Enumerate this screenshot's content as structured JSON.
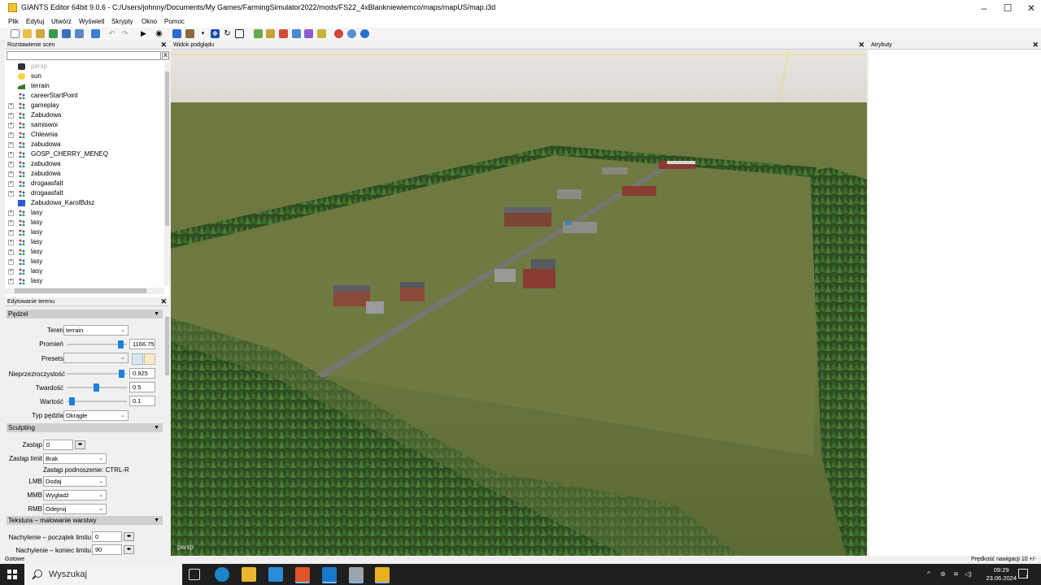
{
  "window": {
    "title": "GIANTS Editor 64bit 9.0.6 - C:/Users/johnny/Documents/My Games/FarmingSimulator2022/mods/FS22_4xBlankniewiemco/maps/mapUS/map.i3d"
  },
  "menubar": {
    "items": [
      "Plik",
      "Edytuj",
      "Utwórz",
      "Wyświetl",
      "Skrypty",
      "Okno",
      "Pomoc"
    ]
  },
  "scene_panel": {
    "title": "Rozstawienie scen",
    "search_clear": "X",
    "tree": [
      {
        "label": "persp",
        "icon": "camera-icon",
        "expandable": false,
        "dim": true
      },
      {
        "label": "sun",
        "icon": "bulb-icon",
        "expandable": false
      },
      {
        "label": "terrain",
        "icon": "terrain-icon",
        "expandable": false
      },
      {
        "label": "careerStartPoint",
        "icon": "transformgroup-icon",
        "expandable": false
      },
      {
        "label": "gameplay",
        "icon": "transformgroup-icon",
        "expandable": true
      },
      {
        "label": "Zabudowa",
        "icon": "transformgroup-icon",
        "expandable": true
      },
      {
        "label": "samiswoi",
        "icon": "transformgroup-icon",
        "expandable": true
      },
      {
        "label": "Chlewnia",
        "icon": "transformgroup-icon",
        "expandable": true
      },
      {
        "label": "zabudowa",
        "icon": "transformgroup-icon",
        "expandable": true
      },
      {
        "label": "GOSP_CHERRY_MENEQ",
        "icon": "transformgroup-icon",
        "expandable": true
      },
      {
        "label": "zabudowa",
        "icon": "transformgroup-icon",
        "expandable": true
      },
      {
        "label": "zabudowa",
        "icon": "transformgroup-icon",
        "expandable": true
      },
      {
        "label": "drogaasfalt",
        "icon": "transformgroup-icon",
        "expandable": true
      },
      {
        "label": "drogaasfalt",
        "icon": "transformgroup-icon",
        "expandable": true
      },
      {
        "label": "Zabudowa_KarolBdsz",
        "icon": "cube-icon",
        "expandable": false
      },
      {
        "label": "lasy",
        "icon": "transformgroup-icon",
        "expandable": true
      },
      {
        "label": "lasy",
        "icon": "transformgroup-icon",
        "expandable": true
      },
      {
        "label": "lasy",
        "icon": "transformgroup-icon",
        "expandable": true
      },
      {
        "label": "lasy",
        "icon": "transformgroup-icon",
        "expandable": true
      },
      {
        "label": "lasy",
        "icon": "transformgroup-icon",
        "expandable": true
      },
      {
        "label": "lasy",
        "icon": "transformgroup-icon",
        "expandable": true
      },
      {
        "label": "lasy",
        "icon": "transformgroup-icon",
        "expandable": true
      },
      {
        "label": "lasy",
        "icon": "transformgroup-icon",
        "expandable": true
      }
    ]
  },
  "terrain_panel": {
    "title": "Edytowanie terenu",
    "brush": {
      "section": "Pędzel",
      "teren_label": "Teren",
      "teren_value": "terrain",
      "radius_label": "Promień",
      "radius_value": "1166.75",
      "radius_level": 0.9,
      "presets_label": "Presets",
      "presets_value": "",
      "opacity_label": "Nieprzezroczystość",
      "opacity_value": "0.925",
      "opacity_level": 0.925,
      "hardness_label": "Twardość",
      "hardness_value": "0.5",
      "hardness_level": 0.5,
      "value_label": "Wartość",
      "value_value": "0.1",
      "value_level": 0.1,
      "shape_label": "Typ pędzla",
      "shape_value": "Okrągłe"
    },
    "sculpting": {
      "section": "Sculpting",
      "replace_label": "Zastąp",
      "replace_value": "0",
      "limit_label": "Zastąp limit",
      "limit_value": "Brak",
      "hint": "Zastąp podnoszenie: CTRL-R",
      "lmb_label": "LMB",
      "lmb_value": "Dodaj",
      "mmb_label": "MMB",
      "mmb_value": "Wygładź",
      "rmb_label": "RMB",
      "rmb_value": "Odejmij"
    },
    "texture": {
      "section": "Tekstura – malowanie warstwy",
      "slope_start_label": "Nachylenie – początek limitu",
      "slope_start_value": "0",
      "slope_end_label": "Nachylenie – koniec limitu",
      "slope_end_value": "90"
    }
  },
  "viewport": {
    "title": "Widok podglądu",
    "camera_label": "persp"
  },
  "attributes_panel": {
    "title": "Atrybuty"
  },
  "statusbar": {
    "left": "Gotowe",
    "right": "Prędkość nawigacji 10 +/-"
  },
  "taskbar": {
    "search_placeholder": "Wyszukaj",
    "time": "09:29",
    "date": "23.06.2024",
    "notification_count": "1"
  }
}
